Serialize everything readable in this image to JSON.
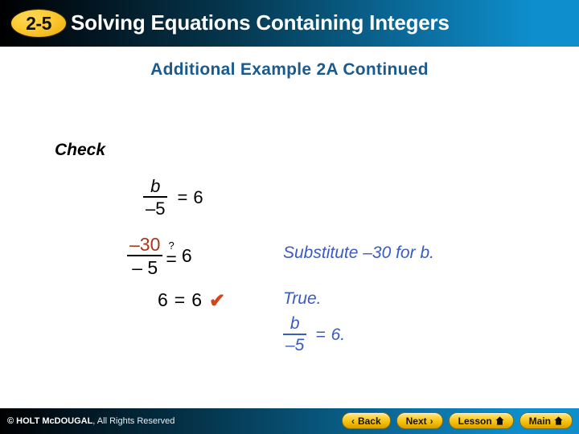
{
  "header": {
    "badge": "2-5",
    "title": "Solving Equations Containing Integers",
    "accent_blue": "#0e8ecc",
    "badge_color": "#fbc92f"
  },
  "subtitle": "Additional Example 2A Continued",
  "check_label": "Check",
  "equations": {
    "line1": {
      "numerator": "b",
      "denominator": "–5",
      "equals": "=",
      "right": "6"
    },
    "line2": {
      "numerator": "–30",
      "denominator": "– 5",
      "question_mark": "?",
      "equals": "=",
      "right": "6",
      "numerator_color": "#a8381b"
    },
    "line3": {
      "left": "6",
      "equals": "=",
      "right": "6",
      "check_mark": "✔",
      "check_color": "#d8431a"
    }
  },
  "annotations": {
    "substitute": "Substitute –30 for b.",
    "true_label": "True.",
    "true_fraction": {
      "numerator": "b",
      "denominator": "–5",
      "equals": "=",
      "right": "6."
    },
    "color": "#3a5bc0"
  },
  "footer": {
    "copyright_bold": "© HOLT McDOUGAL",
    "copyright_rest": ", All Rights Reserved",
    "buttons": [
      {
        "label": "Back",
        "chevron": "‹",
        "chevron_side": "left",
        "icon": ""
      },
      {
        "label": "Next",
        "chevron": "›",
        "chevron_side": "right",
        "icon": ""
      },
      {
        "label": "Lesson",
        "chevron": "",
        "chevron_side": "",
        "icon": "home-icon"
      },
      {
        "label": "Main",
        "chevron": "",
        "chevron_side": "",
        "icon": "home-icon"
      }
    ]
  }
}
